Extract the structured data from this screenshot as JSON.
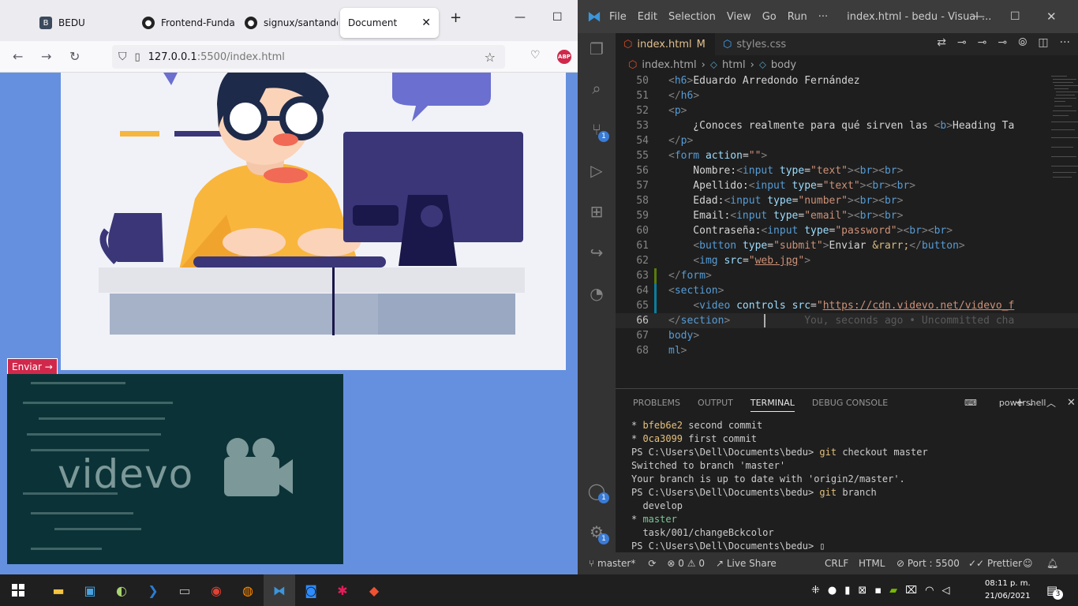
{
  "browser": {
    "tabs": [
      {
        "label": "BEDU",
        "icon": "bedu-icon"
      },
      {
        "label": "Frontend-Funda",
        "icon": "github-icon"
      },
      {
        "label": "signux/santande",
        "icon": "github-icon"
      },
      {
        "label": "Document",
        "icon": "document-icon",
        "active": true
      }
    ],
    "new_tab": "+",
    "url_host": "127.0.0.1",
    "url_rest": ":5500/index.html",
    "submit_button": "Enviar →",
    "video_brand": "videvo"
  },
  "vscode": {
    "menu": [
      "File",
      "Edit",
      "Selection",
      "View",
      "Go",
      "Run",
      "···"
    ],
    "window_title": "index.html - bedu - Visual ...",
    "tabs": [
      {
        "label": "index.html",
        "modifier": "M",
        "active": true
      },
      {
        "label": "styles.css"
      }
    ],
    "breadcrumb": [
      "index.html",
      "html",
      "body"
    ],
    "code_lines": [
      {
        "n": "50",
        "html": "<span class='p'>&lt;</span><span class='t'>h6</span><span class='p'>&gt;</span>Eduardo Arredondo Fernández"
      },
      {
        "n": "51",
        "html": "<span class='p'>&lt;/</span><span class='t'>h6</span><span class='p'>&gt;</span>"
      },
      {
        "n": "52",
        "html": "<span class='p'>&lt;</span><span class='t'>p</span><span class='p'>&gt;</span>"
      },
      {
        "n": "53",
        "html": "    ¿Conoces realmente para qué sirven las <span class='p'>&lt;</span><span class='t'>b</span><span class='p'>&gt;</span>Heading Ta"
      },
      {
        "n": "54",
        "html": "<span class='p'>&lt;/</span><span class='t'>p</span><span class='p'>&gt;</span>"
      },
      {
        "n": "55",
        "html": "<span class='p'>&lt;</span><span class='t'>form</span> <span class='a'>action</span>=<span class='s'>\"\"</span><span class='p'>&gt;</span>"
      },
      {
        "n": "56",
        "html": "    Nombre:<span class='p'>&lt;</span><span class='t'>input</span> <span class='a'>type</span>=<span class='s'>\"text\"</span><span class='p'>&gt;&lt;</span><span class='t'>br</span><span class='p'>&gt;&lt;</span><span class='t'>br</span><span class='p'>&gt;</span>"
      },
      {
        "n": "57",
        "html": "    Apellido:<span class='p'>&lt;</span><span class='t'>input</span> <span class='a'>type</span>=<span class='s'>\"text\"</span><span class='p'>&gt;&lt;</span><span class='t'>br</span><span class='p'>&gt;&lt;</span><span class='t'>br</span><span class='p'>&gt;</span>"
      },
      {
        "n": "58",
        "html": "    Edad:<span class='p'>&lt;</span><span class='t'>input</span> <span class='a'>type</span>=<span class='s'>\"number\"</span><span class='p'>&gt;&lt;</span><span class='t'>br</span><span class='p'>&gt;&lt;</span><span class='t'>br</span><span class='p'>&gt;</span>"
      },
      {
        "n": "59",
        "html": "    Email:<span class='p'>&lt;</span><span class='t'>input</span> <span class='a'>type</span>=<span class='s'>\"email\"</span><span class='p'>&gt;&lt;</span><span class='t'>br</span><span class='p'>&gt;&lt;</span><span class='t'>br</span><span class='p'>&gt;</span>"
      },
      {
        "n": "60",
        "html": "    Contraseña:<span class='p'>&lt;</span><span class='t'>input</span> <span class='a'>type</span>=<span class='s'>\"password\"</span><span class='p'>&gt;&lt;</span><span class='t'>br</span><span class='p'>&gt;&lt;</span><span class='t'>br</span><span class='p'>&gt;</span>"
      },
      {
        "n": "61",
        "html": "    <span class='p'>&lt;</span><span class='t'>button</span> <span class='a'>type</span>=<span class='s'>\"submit\"</span><span class='p'>&gt;</span>Enviar <span class='e'>&amp;rarr;</span><span class='p'>&lt;/</span><span class='t'>button</span><span class='p'>&gt;</span>"
      },
      {
        "n": "62",
        "html": "    <span class='p'>&lt;</span><span class='t'>img</span> <span class='a'>src</span>=<span class='s'>\"<u>web.jpg</u>\"</span><span class='p'>&gt;</span>"
      },
      {
        "n": "63",
        "html": "<span class='p'>&lt;/</span><span class='t'>form</span><span class='p'>&gt;</span>"
      },
      {
        "n": "64",
        "html": "<span class='p'>&lt;</span><span class='t'>section</span><span class='p'>&gt;</span>"
      },
      {
        "n": "65",
        "html": "    <span class='p'>&lt;</span><span class='t'>video</span> <span class='a'>controls</span> <span class='a'>src</span>=<span class='s'>\"<u>https://cdn.videvo.net/videvo_f</u></span>"
      },
      {
        "n": "66",
        "html": "<span class='p'>&lt;/</span><span class='t'>section</span><span class='p'>&gt;</span>            <span style='color:#5a5a5a'>You, seconds ago • Uncommitted cha</span>"
      },
      {
        "n": "67",
        "html": "<span class='t'>body</span><span class='p'>&gt;</span>"
      },
      {
        "n": "68",
        "html": "<span class='t'>ml</span><span class='p'>&gt;</span>"
      }
    ],
    "panel_tabs": [
      "PROBLEMS",
      "OUTPUT",
      "TERMINAL",
      "DEBUG CONSOLE"
    ],
    "shell": "powershell",
    "terminal": [
      "* <y>bfeb6e2</y> second commit",
      "* <y>0ca3099</y> first commit",
      "PS C:\\Users\\Dell\\Documents\\bedu> <y>git</y> checkout master",
      "Switched to branch 'master'",
      "Your branch is up to date with 'origin2/master'.",
      "PS C:\\Users\\Dell\\Documents\\bedu> <y>git</y> branch",
      "  develop",
      "* <g>master</g>",
      "  task/001/changeBckcolor",
      "PS C:\\Users\\Dell\\Documents\\bedu> ▯"
    ],
    "status": {
      "branch": "master*",
      "errors": "0",
      "warnings": "0",
      "live_share": "Live Share",
      "eol": "CRLF",
      "lang": "HTML",
      "port": "Port : 5500",
      "prettier": "Prettier"
    }
  },
  "taskbar": {
    "time": "08:11 p. m.",
    "date": "21/06/2021",
    "notifications": "3"
  }
}
